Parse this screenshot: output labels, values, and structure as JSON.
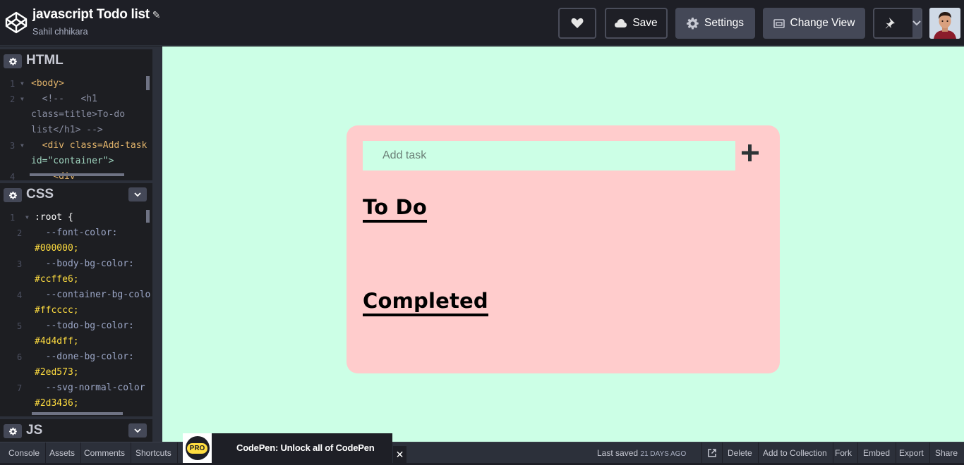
{
  "header": {
    "pen_title": "javascript Todo list",
    "edit_icon": "pencil-icon",
    "author": "Sahil chhikara",
    "buttons": {
      "like_icon": "heart-icon",
      "save_label": "Save",
      "settings_label": "Settings",
      "change_view_label": "Change View",
      "pin_icon": "pin-icon"
    }
  },
  "editors": {
    "html": {
      "label": "HTML",
      "lines": [
        {
          "num": "1",
          "code": "<body>"
        },
        {
          "num": "2",
          "code": "  <!--   <h1"
        },
        {
          "num": "",
          "code": "class=title>To-do"
        },
        {
          "num": "",
          "code": "list</h1> -->"
        },
        {
          "num": "3",
          "code": "  <div class=Add-task"
        },
        {
          "num": "",
          "code": "id=\"container\">"
        },
        {
          "num": "4",
          "code": "    <div"
        }
      ]
    },
    "css": {
      "label": "CSS",
      "lines": [
        {
          "num": "1",
          "code": ":root {"
        },
        {
          "num": "2",
          "prop": "  --font-color:",
          "val": "#000000;"
        },
        {
          "num": "3",
          "prop": "  --body-bg-color:",
          "val": "#ccffe6;"
        },
        {
          "num": "4",
          "prop": "  --container-bg-colo",
          "val": "#ffcccc;"
        },
        {
          "num": "5",
          "prop": "  --todo-bg-color:",
          "val": "#4d4dff;"
        },
        {
          "num": "6",
          "prop": "  --done-bg-color:",
          "val": "#2ed573;"
        },
        {
          "num": "7",
          "prop": "  --svg-normal-color",
          "val": "#2d3436;"
        }
      ]
    },
    "js": {
      "label": "JS"
    }
  },
  "preview": {
    "input_placeholder": "Add task",
    "todo_heading": "To Do",
    "completed_heading": "Completed",
    "colors": {
      "body_bg": "#ccffe6",
      "container_bg": "#ffcccc",
      "font": "#000000"
    }
  },
  "footer": {
    "console": "Console",
    "assets": "Assets",
    "comments": "Comments",
    "shortcuts": "Shortcuts",
    "promo_badge": "PRO",
    "promo_text": "CodePen: Unlock all of CodePen",
    "last_saved_label": "Last saved",
    "last_saved_value": "21 DAYS AGO",
    "delete": "Delete",
    "add_to_collection": "Add to Collection",
    "fork": "Fork",
    "embed": "Embed",
    "export": "Export",
    "share": "Share"
  }
}
